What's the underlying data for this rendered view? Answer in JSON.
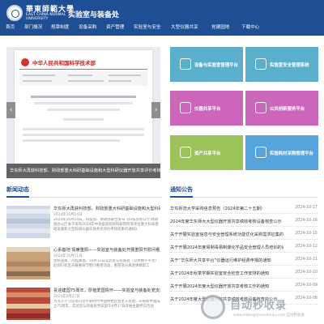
{
  "header": {
    "logo_cn": "華東師範大學",
    "logo_en": "EAST CHINA NORMAL UNIVERSITY",
    "department": "实验室与装备处",
    "bg_color": "#1e4f95",
    "nav": [
      "首页",
      "部门概况",
      "规章制度",
      "设备采购",
      "资产管理",
      "实验室与安全",
      "大型仪器共享",
      "党建园地",
      "下载中心"
    ]
  },
  "carousel": {
    "doc_header": "中华人民共和国科学技术部",
    "caption": "华东师大再获科技部、财政部重大科研基础设施和大型科研仪器开放共享评价考核“优秀”",
    "prev_icon": "chevron-left-icon",
    "next_icon": "chevron-right-icon"
  },
  "tiles": [
    {
      "label": "设备与实验室管理平台",
      "color": "#5ab0cc"
    },
    {
      "label": "实验室安全管理系统",
      "color": "#5ab0cc"
    },
    {
      "label": "仪器共享平台",
      "color": "#cc66bb"
    },
    {
      "label": "公共创新服务平台",
      "color": "#cc66bb"
    },
    {
      "label": "资产共享平台",
      "color": "#9cc25a"
    },
    {
      "label": "实验耗材采购管理平台",
      "color": "#56a4dd"
    }
  ],
  "news": {
    "title": "新闻动态",
    "items": [
      {
        "title": "华东师大再获科技部、财政部重大科研基础设施和大型科研仪器开放共享评价考核“优秀”",
        "date": "2024年10月14日",
        "summary": "2024年10月14日，科技部、财政部联合发布《科技部办公厅 财政部办公厅关于发布2024年中央级高校和科研院所等单位重大科研基础设施和大型科研仪器开放共享评价考核结果的通知》"
      },
      {
        "title": "心系基地 情暖重阳——实验室与装备处开展重阳节慰问看望活动",
        "date": "2024年10月11日",
        "summary": "金秋送爽，丹桂飘香。10月11日实验室与装备处（公共数字平台）赴闵行校区开展重阳节慰问看望活动，看望部分离退休教职工"
      },
      {
        "title": "喜迎建国75周年，厚植爱国情怀——实验室与装备处党支部开展主题党日活动",
        "date": "2024年9月27日",
        "summary": "为深入学习贯彻习近平新时代中国特色社会主义思想，庆祝新中国成立75周年，实验室与装备处党支部于9月27日开展主题党日活动"
      }
    ]
  },
  "notices": {
    "title": "通知公告",
    "items": [
      {
        "title": "华东师范大学采购信息预告（2024年第二十五期）",
        "date": "2024-10-17"
      },
      {
        "title": "2024年度华东师大大型仪器开放共享绩效考核设备核查公示",
        "date": "2024-10-16"
      },
      {
        "title": "关于开展实验室信息与安全管理系统功能优化采购需求征集的通知",
        "date": "2024-10-15"
      },
      {
        "title": "关于开展2024年度易制毒易制爆化学品安全管理人员培训的通知",
        "date": "2024-10-12"
      },
      {
        "title": "关于“华东师大共享平台”仪器运行维护经费申报的通知",
        "date": "2024-10-11"
      },
      {
        "title": "关于2024年秋季学期实验室安全检查工作安排的通知",
        "date": "2024-10-10"
      },
      {
        "title": "关于开展2024年度大型仪器开放共享考核工作的通知",
        "date": "2024-10-09"
      },
      {
        "title": "关于2024年度大型仪器开放共享绩效考核设备核查的公示",
        "date": "2024-10-08"
      }
    ]
  },
  "watermark": {
    "main": "自动秒收录",
    "sub": "www.zidongmiaoshoulu.com 自动秒收录"
  }
}
